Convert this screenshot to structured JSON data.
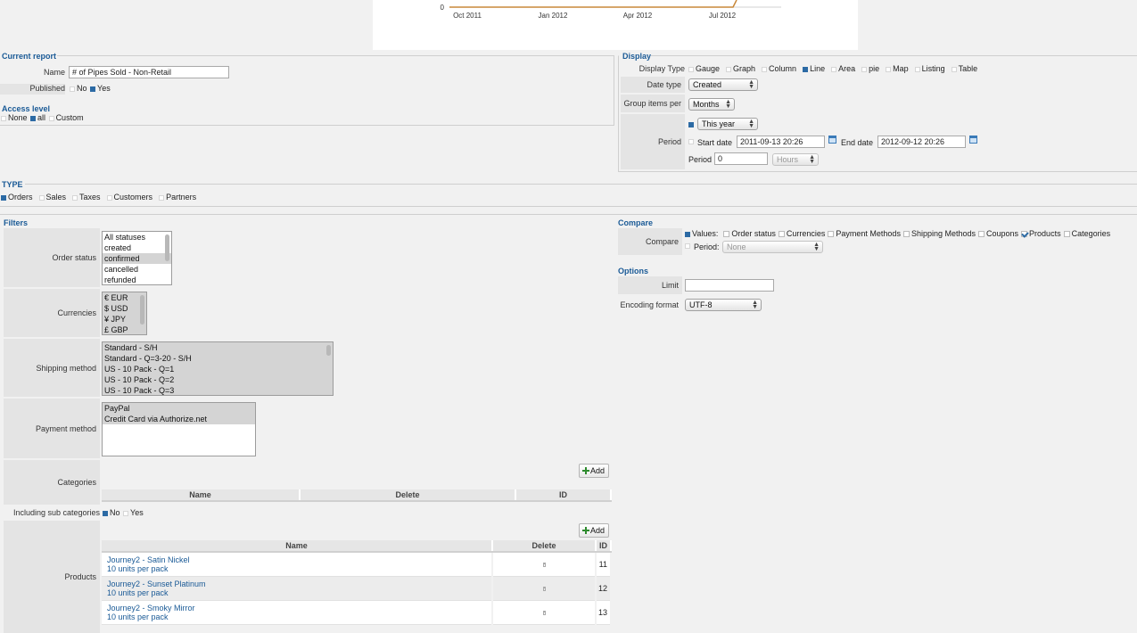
{
  "chart_data": {
    "type": "line",
    "x_ticks": [
      "Oct 2011",
      "Jan 2012",
      "Apr 2012",
      "Jul 2012"
    ],
    "y_ticks": [
      "0"
    ],
    "line_color": "#c8883a"
  },
  "current_report": {
    "title": "Current report",
    "name_label": "Name",
    "name_value": "# of Pipes Sold - Non-Retail",
    "published_label": "Published",
    "published_options": [
      "No",
      "Yes"
    ],
    "published_selected": "Yes",
    "access_title": "Access level",
    "access_options": [
      "None",
      "all",
      "Custom"
    ],
    "access_selected": "all"
  },
  "display": {
    "title": "Display",
    "display_type_label": "Display Type",
    "display_types": [
      "Gauge",
      "Graph",
      "Column",
      "Line",
      "Area",
      "pie",
      "Map",
      "Listing",
      "Table"
    ],
    "display_type_selected": "Line",
    "date_type_label": "Date type",
    "date_type_value": "Created",
    "group_label": "Group items per",
    "group_value": "Months",
    "period_label": "Period",
    "period_value": "This year",
    "start_date_label": "Start date",
    "start_date_value": "2011-09-13 20:26",
    "end_date_label": "End date",
    "end_date_value": "2012-09-12 20:26",
    "period_count_label": "Period",
    "period_count_value": "0",
    "period_unit": "Hours"
  },
  "type": {
    "title": "TYPE",
    "options": [
      "Orders",
      "Sales",
      "Taxes",
      "Customers",
      "Partners"
    ],
    "selected": "Orders"
  },
  "filters": {
    "title": "Filters",
    "order_status_label": "Order status",
    "order_statuses": [
      "All statuses",
      "created",
      "confirmed",
      "cancelled",
      "refunded"
    ],
    "order_status_selected": "confirmed",
    "currencies_label": "Currencies",
    "currencies": [
      "€ EUR",
      "$ USD",
      "¥ JPY",
      "£ GBP"
    ],
    "shipping_label": "Shipping method",
    "shipping_methods": [
      "Standard - S/H",
      "Standard - Q=3-20 - S/H",
      "US - 10 Pack - Q=1",
      "US - 10 Pack - Q=2",
      "US - 10 Pack - Q=3"
    ],
    "payment_label": "Payment method",
    "payment_methods": [
      "PayPal",
      "Credit Card via Authorize.net"
    ],
    "categories_label": "Categories",
    "add_label": "Add",
    "categories_headers": [
      "Name",
      "Delete",
      "ID"
    ],
    "subcat_label": "Including sub categories",
    "subcat_options": [
      "No",
      "Yes"
    ],
    "subcat_selected": "No",
    "products_label": "Products",
    "products_headers": [
      "Name",
      "Delete",
      "ID"
    ],
    "products": [
      {
        "name": "Journey2 - Satin Nickel",
        "sub": "10 units per pack",
        "id": "11"
      },
      {
        "name": "Journey2 - Sunset Platinum",
        "sub": "10 units per pack",
        "id": "12"
      },
      {
        "name": "Journey2 - Smoky Mirror",
        "sub": "10 units per pack",
        "id": "13"
      }
    ]
  },
  "compare": {
    "title": "Compare",
    "label": "Compare",
    "values_label": "Values:",
    "values_options": [
      "Order status",
      "Currencies",
      "Payment Methods",
      "Shipping Methods",
      "Coupons",
      "Products",
      "Categories"
    ],
    "values_checked": "Products",
    "period_label": "Period:",
    "period_value": "None"
  },
  "options": {
    "title": "Options",
    "limit_label": "Limit",
    "limit_value": "",
    "encoding_label": "Encoding format",
    "encoding_value": "UTF-8"
  }
}
